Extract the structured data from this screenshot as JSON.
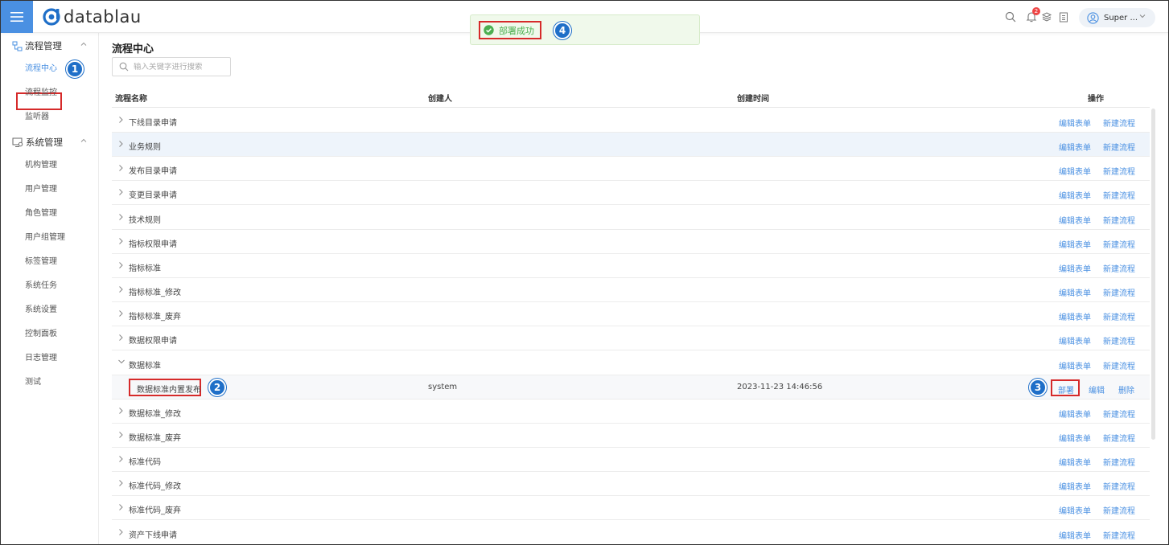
{
  "header": {
    "logo_text": "datablau",
    "notification_count": "2",
    "user_name": "Super ..."
  },
  "toast": {
    "message": "部署成功",
    "step": "4"
  },
  "sidebar": {
    "group1": "流程管理",
    "group1_items": [
      "流程中心",
      "流程监控",
      "监听器"
    ],
    "group2": "系统管理",
    "group2_items": [
      "机构管理",
      "用户管理",
      "角色管理",
      "用户组管理",
      "标签管理",
      "系统任务",
      "系统设置",
      "控制面板",
      "日志管理",
      "测试"
    ],
    "step": "1"
  },
  "main": {
    "title": "流程中心",
    "search_placeholder": "输入关键字进行搜索",
    "columns": {
      "name": "流程名称",
      "creator": "创建人",
      "time": "创建时间",
      "ops": "操作"
    },
    "action_edit_form": "编辑表单",
    "action_new_flow": "新建流程",
    "rows": [
      "下线目录申请",
      "业务规则",
      "发布目录申请",
      "变更目录申请",
      "技术规则",
      "指标权限申请",
      "指标标准",
      "指标标准_修改",
      "指标标准_废弃",
      "数据权限申请",
      "数据标准",
      "数据标准_修改",
      "数据标准_废弃",
      "标准代码",
      "标准代码_修改",
      "标准代码_废弃",
      "资产下线申请"
    ],
    "child_row": {
      "name": "数据标准内置发布",
      "creator": "system",
      "time": "2023-11-23 14:46:56",
      "deploy": "部署",
      "edit": "编辑",
      "delete": "删除",
      "name_step": "2",
      "deploy_step": "3"
    }
  },
  "colors": {
    "accent": "#4a90e2",
    "highlight_box": "#d62a2a",
    "success": "#4caf50",
    "step_marker": "#1f6fc8"
  }
}
